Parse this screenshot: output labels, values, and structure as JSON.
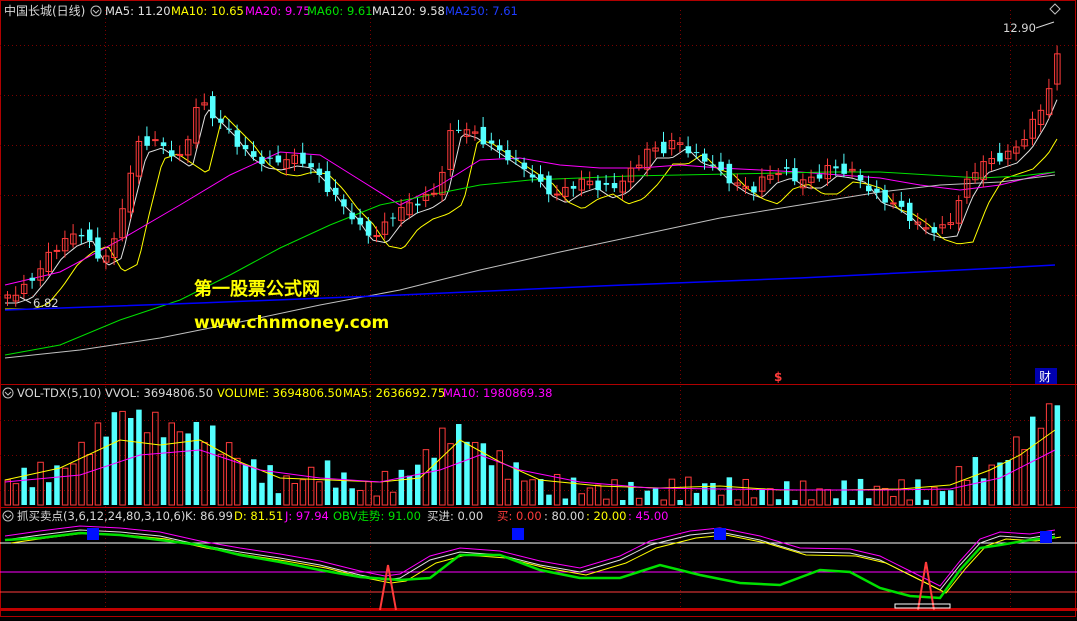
{
  "colors": {
    "background": "#000000",
    "divider": "#b00000",
    "grid": "#7a0000",
    "up": "#ff3b3b",
    "down": "#54ffff",
    "white_text": "#d8d8d8",
    "ma5": "#e0e0e0",
    "ma10": "#ffff00",
    "ma20": "#ff00ff",
    "ma60": "#00e000",
    "ma120": "#c0c0c0",
    "ma250": "#0000ff",
    "watermark": "#ffff00"
  },
  "price_panel": {
    "stock_name": "中国长城(日线)",
    "legend": [
      {
        "label": "MA5: 11.20",
        "color": "#e0e0e0"
      },
      {
        "label": "MA10: 10.65",
        "color": "#ffff00"
      },
      {
        "label": "MA20: 9.75",
        "color": "#ff00ff"
      },
      {
        "label": "MA60: 9.61",
        "color": "#00e000"
      },
      {
        "label": "MA120: 9.58",
        "color": "#e0e0e0"
      },
      {
        "label": "MA250: 7.61",
        "color": "#0000ff"
      }
    ],
    "high_label": "12.90",
    "low_label": "6.82",
    "event_marker_s": "$",
    "event_marker_fin": "财",
    "watermark_title": "第一股票公式网",
    "watermark_url": "www.chnmoney.com"
  },
  "volume_panel": {
    "legend": [
      {
        "label": "VOL-TDX(5,10)",
        "color": "#d8d8d8"
      },
      {
        "label": "VVOL: 3694806.50",
        "color": "#d8d8d8"
      },
      {
        "label": "VOLUME: 3694806.50",
        "color": "#ffff00"
      },
      {
        "label": "MA5: 2636692.75",
        "color": "#ffff00"
      },
      {
        "label": "MA10: 1980869.38",
        "color": "#ff00ff"
      }
    ]
  },
  "indicator_panel": {
    "legend": [
      {
        "label": "抓买卖点(3,6,12,24,80,3,10,6)",
        "color": "#d8d8d8"
      },
      {
        "label": "K: 86.99",
        "color": "#d8d8d8"
      },
      {
        "label": "D: 81.51",
        "color": "#ffff00"
      },
      {
        "label": "J: 97.94",
        "color": "#ff00ff"
      },
      {
        "label": "OBV走势: 91.00",
        "color": "#00e000"
      },
      {
        "label": "买进: 0.00",
        "color": "#d8d8d8"
      },
      {
        "label": "买: 0.00",
        "color": "#ff3b3b"
      },
      {
        "label": ": 80.00",
        "color": "#d8d8d8"
      },
      {
        "label": ": 20.00",
        "color": "#ffff00"
      },
      {
        "label": ": 45.00",
        "color": "#ff00ff"
      }
    ]
  }
}
